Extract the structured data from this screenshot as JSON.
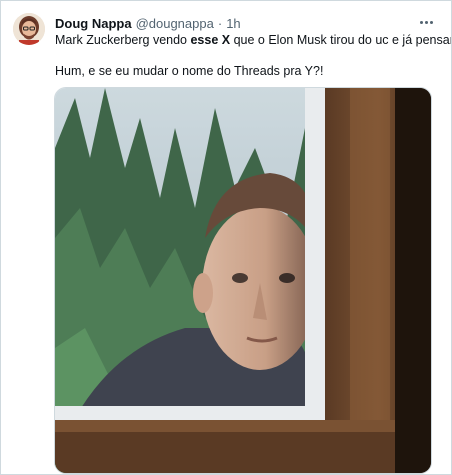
{
  "tweet": {
    "display_name": "Doug Nappa",
    "handle": "@dougnappa",
    "separator": "·",
    "time": "1h",
    "line1_before": "Mark Zuckerberg vendo ",
    "line1_bold": "esse X",
    "line1_after": " que o Elon Musk tirou do uc e já pensando:",
    "line2": "Hum, e se eu mudar o nome do Threads pra Y?!"
  },
  "icons": {
    "more": "more-options-icon",
    "avatar": "user-avatar"
  },
  "colors": {
    "text": "#0f1419",
    "secondary": "#536471",
    "border": "#cfd9de"
  }
}
